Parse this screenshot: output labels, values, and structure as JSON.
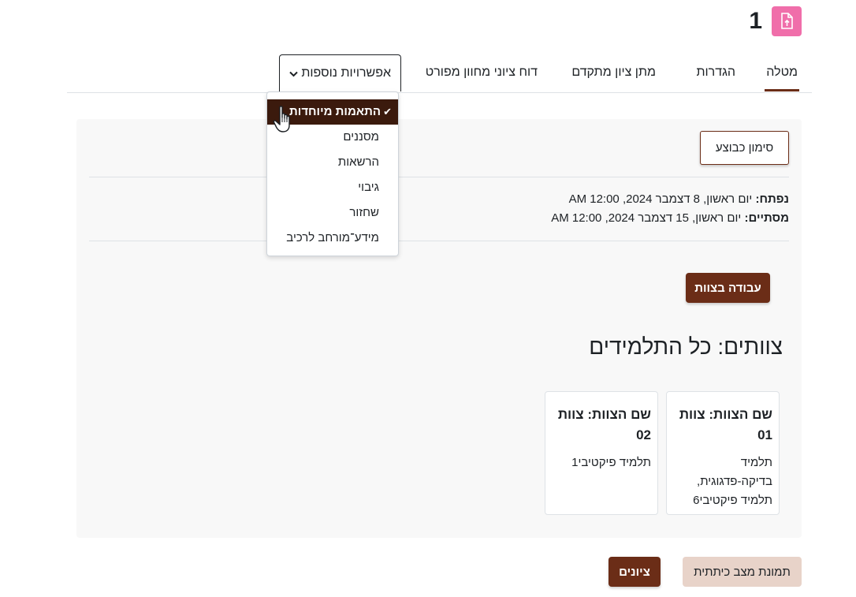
{
  "header": {
    "page_number": "1",
    "icon": "upload-file-icon"
  },
  "tabs": {
    "items": [
      {
        "label": "מטלה",
        "active": true
      },
      {
        "label": "הגדרות",
        "active": false
      },
      {
        "label": "מתן ציון מתקדם",
        "active": false
      },
      {
        "label": "דוח ציוני מחוון מפורט",
        "active": false
      }
    ],
    "more_label": "אפשרויות נוספות"
  },
  "dropdown": {
    "items": [
      {
        "label": "התאמות מיוחדות",
        "selected": true
      },
      {
        "label": "מסננים",
        "selected": false
      },
      {
        "label": "הרשאות",
        "selected": false
      },
      {
        "label": "גיבוי",
        "selected": false
      },
      {
        "label": "שחזור",
        "selected": false
      },
      {
        "label": "מידע־מורחב לרכיב",
        "selected": false
      }
    ]
  },
  "main": {
    "mark_done_label": "סימון כבוצע",
    "opened_label": "נפתח:",
    "opened_value": "יום ראשון, 8 דצמבר 2024, 12:00 AM",
    "due_label": "מסתיים:",
    "due_value": "יום ראשון, 15 דצמבר 2024, 12:00 AM",
    "team_work_label": "עבודה בצוות",
    "teams_heading": "צוותים: כל התלמידים",
    "teams": [
      {
        "title": "שם הצוות: צוות 01",
        "members": "תלמיד בדיקה-פדגוגית, תלמיד פיקטיבי6"
      },
      {
        "title": "שם הצוות: צוות 02",
        "members": "תלמיד פיקטיבי1"
      }
    ]
  },
  "footer": {
    "grades_label": "ציונים",
    "class_snapshot_label": "תמונת מצב כיתתית"
  },
  "colors": {
    "accent": "#6b2d17",
    "accent_dark": "#3b1a0d",
    "icon_pink": "#f06eaa",
    "light_button": "#e8d3c9"
  }
}
